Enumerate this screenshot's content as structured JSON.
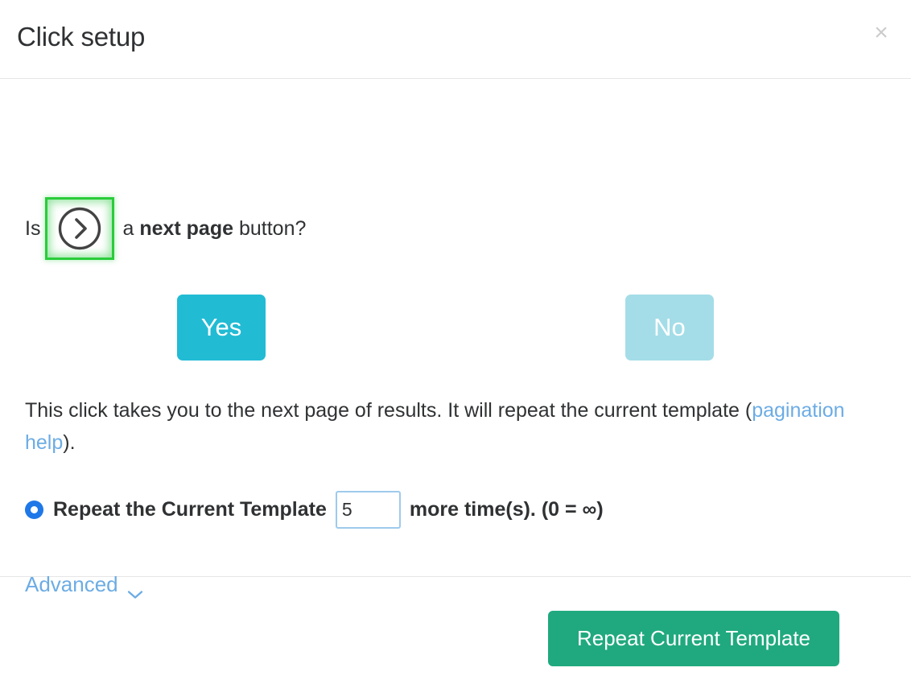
{
  "header": {
    "title": "Click setup",
    "close_label": "×"
  },
  "question": {
    "lead": "Is",
    "target_icon": "circle-chevron-right-icon",
    "tail_before": "a ",
    "tail_strong": "next page",
    "tail_after": " button?",
    "highlight_color": "#29cc3a"
  },
  "choices": {
    "yes_label": "Yes",
    "no_label": "No",
    "yes_color": "#22bbd4",
    "no_color": "#a4dde8"
  },
  "description": {
    "text_before": "This click takes you to the next page of results. It will repeat the current template (",
    "link_label": "pagination help",
    "text_after": ")."
  },
  "option": {
    "radio_selected": true,
    "label": "Repeat the Current Template",
    "input_value": "5",
    "input_placeholder": "",
    "suffix": "more time(s). (0 = ∞)",
    "radio_color": "#1f78e8"
  },
  "advanced": {
    "label": "Advanced",
    "icon": "chevron-down-icon",
    "color": "#6cace4"
  },
  "footer": {
    "primary_label": "Repeat Current Template",
    "primary_color": "#20a97e"
  }
}
